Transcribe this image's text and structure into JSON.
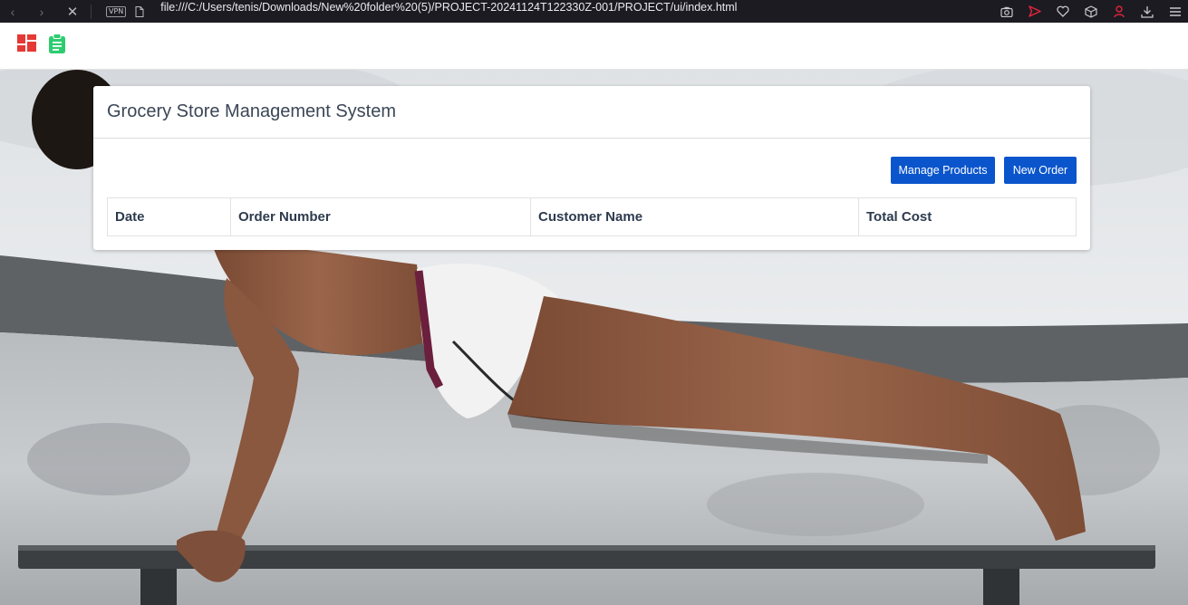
{
  "browser": {
    "url": "file:///C:/Users/tenis/Downloads/New%20folder%20(5)/PROJECT-20241124T122330Z-001/PROJECT/ui/index.html",
    "vpn_label": "VPN",
    "icons": [
      "back-icon",
      "forward-icon",
      "stop-icon",
      "page-icon",
      "camera-icon",
      "send-icon",
      "heart-icon",
      "box-icon",
      "user-icon",
      "download-icon",
      "menu-icon"
    ]
  },
  "header": {
    "icons": [
      "dashboard-icon",
      "clipboard-icon"
    ],
    "colors": {
      "dashboard": "#e53935",
      "clipboard": "#2ecc71"
    }
  },
  "card": {
    "title": "Grocery Store Management System",
    "buttons": {
      "manage_products": "Manage Products",
      "new_order": "New Order"
    },
    "table": {
      "columns": [
        "Date",
        "Order Number",
        "Customer Name",
        "Total Cost"
      ],
      "rows": []
    }
  },
  "colors": {
    "primary_button": "#0a55cc",
    "browser_bar": "#1c1b22",
    "title_text": "#3b4656"
  }
}
